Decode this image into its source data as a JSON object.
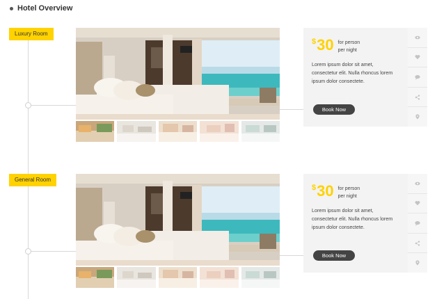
{
  "section": {
    "title": "Hotel Overview"
  },
  "rooms": [
    {
      "tag": "Luxury Room",
      "price_currency": "$",
      "price_amount": "30",
      "price_line1": "for person",
      "price_line2": "per night",
      "description": "Lorem ipsum dolor sit amet, consectetur elit. Nulla rhoncus lorem ipsum dolor consectete.",
      "book_label": "Book Now"
    },
    {
      "tag": "General Room",
      "price_currency": "$",
      "price_amount": "30",
      "price_line1": "for person",
      "price_line2": "per night",
      "description": "Lorem ipsum dolor sit amet, consectetur elit. Nulla rhoncus lorem ipsum dolor consectete.",
      "book_label": "Book Now"
    }
  ],
  "action_icons": [
    "eye-icon",
    "heart-icon",
    "comment-icon",
    "share-icon",
    "location-pin-icon"
  ],
  "colors": {
    "accent": "#ffd200",
    "button": "#444444",
    "card": "#f3f3f3"
  }
}
